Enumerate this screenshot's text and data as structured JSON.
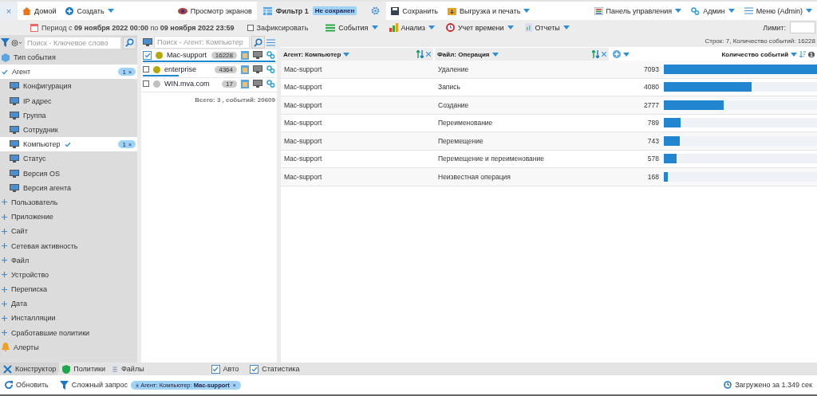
{
  "top_bar": {
    "close": "×",
    "left": [
      {
        "kind": "home",
        "label": "Домой",
        "menu": false
      },
      {
        "kind": "create",
        "label": "Создать",
        "menu": true
      }
    ],
    "screens": {
      "label": "Просмотр экранов"
    },
    "tab": {
      "label": "Фильтр 1",
      "badge": "Не сохранен",
      "selected": true
    },
    "actions": [
      {
        "kind": "save",
        "label": "Сохранить",
        "menu": false
      },
      {
        "kind": "export",
        "label": "Выгрузка и печать",
        "menu": true
      }
    ],
    "right": [
      {
        "kind": "dashboard",
        "label": "Панель управления",
        "menu": true
      },
      {
        "kind": "admin",
        "label": "Админ",
        "menu": true
      },
      {
        "kind": "hamburger",
        "label": "Меню (Admin)",
        "menu": true
      }
    ]
  },
  "toolbar": {
    "period": "Период с **09 ноября 2022 00:00** по **09 ноября 2022 23:59**",
    "fix": {
      "label": "Зафиксировать",
      "checked": false
    },
    "menus": [
      {
        "kind": "events",
        "label": "События"
      },
      {
        "kind": "analysis",
        "label": "Анализ"
      },
      {
        "kind": "time",
        "label": "Учет времени"
      },
      {
        "kind": "reports",
        "label": "Отчеты"
      }
    ],
    "limit_label": "Лимит:"
  },
  "filters": {
    "placeholder": "Поиск - Ключевое слово",
    "items": [
      {
        "kind": "type",
        "label": "Тип события"
      },
      {
        "kind": "group",
        "label": "Агент",
        "expanded": true,
        "selected": true,
        "badge": {
          "count": "1",
          "remove": "×"
        },
        "children": [
          {
            "label": "Конфигурация",
            "selected": false
          },
          {
            "label": "IP адрес",
            "selected": false
          },
          {
            "label": "Группа",
            "selected": false
          },
          {
            "label": "Сотрудник",
            "selected": false
          },
          {
            "label": "Компьютер",
            "selected": true,
            "badge": {
              "count": "1",
              "remove": "×"
            }
          },
          {
            "label": "Статус",
            "selected": false
          },
          {
            "label": "Версия OS",
            "selected": false
          },
          {
            "label": "Версия агента",
            "selected": false
          }
        ]
      },
      {
        "kind": "group",
        "label": "Пользователь",
        "expanded": false,
        "selected": false
      },
      {
        "kind": "group",
        "label": "Приложение",
        "expanded": false,
        "selected": false
      },
      {
        "kind": "group",
        "label": "Сайт",
        "expanded": false,
        "selected": false
      },
      {
        "kind": "group",
        "label": "Сетевая активность",
        "expanded": false,
        "selected": false
      },
      {
        "kind": "group",
        "label": "Файл",
        "expanded": false,
        "selected": false
      },
      {
        "kind": "group",
        "label": "Устройство",
        "expanded": false,
        "selected": false
      },
      {
        "kind": "group",
        "label": "Переписка",
        "expanded": false,
        "selected": false
      },
      {
        "kind": "group",
        "label": "Дата",
        "expanded": false,
        "selected": false
      },
      {
        "kind": "group",
        "label": "Инсталляции",
        "expanded": false,
        "selected": false
      },
      {
        "kind": "group",
        "label": "Сработавшие политики",
        "expanded": false,
        "selected": false
      },
      {
        "kind": "alert",
        "label": "Алерты"
      }
    ]
  },
  "agents": {
    "placeholder": "Поиск - Агент: Компьютер",
    "items": [
      {
        "name": "Mac-support",
        "checked": true,
        "color": "#b5a800",
        "count": "16228",
        "level": 1
      },
      {
        "name": "enterprise",
        "checked": false,
        "color": "#b5a800",
        "count": "4364",
        "level": 0.27
      },
      {
        "name": "WIN.mva.com",
        "checked": false,
        "color": "#c0c0c0",
        "count": "17"
      }
    ],
    "total": "Всего: 3 , событий: 20609"
  },
  "table": {
    "info": "Строк: 7, Количество событий: 16228",
    "columns": [
      "Агент: Компьютер",
      "Файл: Операция",
      "Количество событий"
    ],
    "sort_badge": "1",
    "rows": [
      {
        "agent": "Mac-support",
        "operation": "Удаление",
        "count": "7093",
        "level": 1
      },
      {
        "agent": "Mac-support",
        "operation": "Запись",
        "count": "4080",
        "level": 0.575
      },
      {
        "agent": "Mac-support",
        "operation": "Создание",
        "count": "2777",
        "level": 0.392
      },
      {
        "agent": "Mac-support",
        "operation": "Переименование",
        "count": "789",
        "level": 0.111
      },
      {
        "agent": "Mac-support",
        "operation": "Перемещение",
        "count": "743",
        "level": 0.105
      },
      {
        "agent": "Mac-support",
        "operation": "Перемещение и переименование",
        "count": "578",
        "level": 0.081
      },
      {
        "agent": "Mac-support",
        "operation": "Неизвестная операция",
        "count": "168",
        "level": 0.024
      }
    ]
  },
  "bottom_tabs": [
    {
      "kind": "constructor",
      "label": "Конструктор",
      "selected": true
    },
    {
      "kind": "policies",
      "label": "Политики",
      "selected": false
    },
    {
      "kind": "files",
      "label": "Файлы",
      "selected": false
    }
  ],
  "options": [
    {
      "label": "Авто",
      "checked": true
    },
    {
      "label": "Статистика",
      "checked": true
    }
  ],
  "status_bar": {
    "refresh": "Обновить",
    "query": "Сложный запрос",
    "chip": {
      "text": "± Агент: Компьютер: **Mac-support**",
      "remove": "×"
    },
    "loaded": "Загружено за 1.349 сек"
  }
}
